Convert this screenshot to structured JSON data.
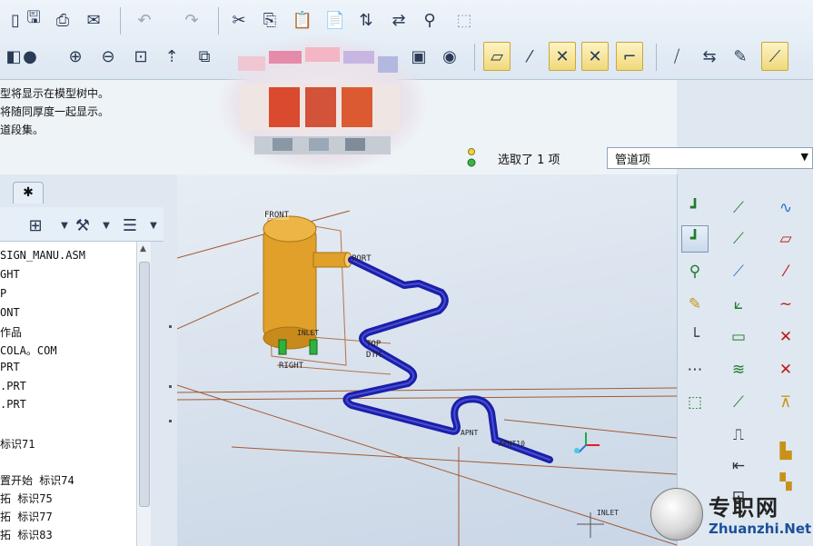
{
  "messages": {
    "line1": "型将显示在模型树中。",
    "line2": "将随同厚度一起显示。",
    "line3": "道段集。"
  },
  "status": {
    "selected": "选取了 1 项"
  },
  "filter": {
    "value": "管道项"
  },
  "tree": {
    "items": [
      "SIGN_MANU.ASM",
      "GHT",
      "P",
      "ONT",
      "作品",
      "COLA。COM",
      "PRT",
      ".PRT",
      ".PRT",
      "",
      " 标识71",
      "",
      "置开始 标识74",
      "拓  标识75",
      "拓  标识77",
      "拓  标识83"
    ]
  },
  "viewport": {
    "labels": {
      "front": "FRONT",
      "port": "PORT",
      "top": "TOP",
      "dtm": "DTM",
      "right": "RIGHT",
      "inlet": "INLET",
      "apnt9": "APNT",
      "apnt10": "APNT10",
      "inlet2": "INLET"
    },
    "colors": {
      "vessel": "#e3a227",
      "pipe": "#1b1fa8",
      "datum": "#a0522d",
      "background": "#d6e0ec"
    }
  },
  "watermark": {
    "title": "专职网",
    "url": "Zhuanzhi.Net"
  },
  "icons": {
    "toolbar_row1": [
      "new-file-icon",
      "save-icon",
      "print-icon",
      "email-icon",
      "undo-icon",
      "redo-icon",
      "cut-icon",
      "copy-icon",
      "paste-icon",
      "paste-special-icon",
      "regenerate-icon",
      "switch-icon",
      "find-icon",
      "select-box-icon"
    ],
    "toolbar_row2": [
      "shading-icon",
      "sphere-icon",
      "zoom-in-icon",
      "zoom-out-icon",
      "refit-icon",
      "orient-icon",
      "view-manager-icon",
      "datum-plane-icon",
      "datum-axis-icon",
      "datum-point-icon",
      "csys-icon",
      "pipe-route-icon",
      "pipe-extend-icon",
      "pipe-info-icon",
      "pipe-solid-icon"
    ]
  }
}
